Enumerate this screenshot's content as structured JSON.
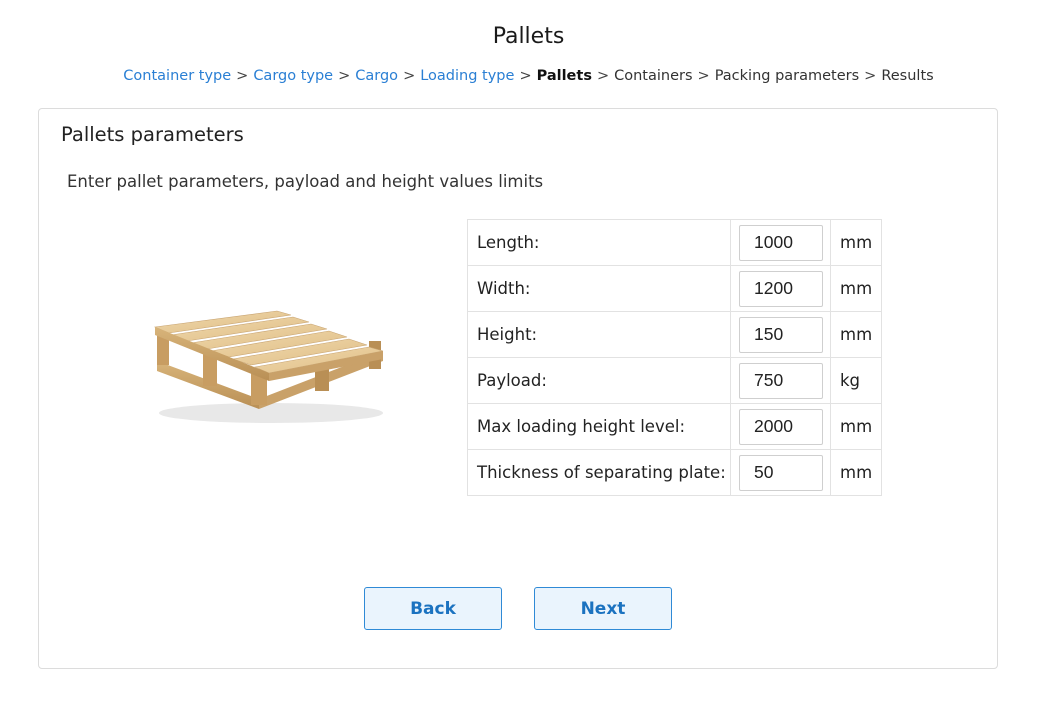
{
  "page": {
    "title": "Pallets"
  },
  "breadcrumb": {
    "separator": ">",
    "items": [
      {
        "label": "Container type"
      },
      {
        "label": "Cargo type"
      },
      {
        "label": "Cargo"
      },
      {
        "label": "Loading type"
      },
      {
        "label": "Pallets"
      },
      {
        "label": "Containers"
      },
      {
        "label": "Packing parameters"
      },
      {
        "label": "Results"
      }
    ]
  },
  "panel": {
    "title": "Pallets parameters",
    "instructions": "Enter pallet parameters, payload and height values limits"
  },
  "params": [
    {
      "label": "Length:",
      "value": "1000",
      "unit": "mm"
    },
    {
      "label": "Width:",
      "value": "1200",
      "unit": "mm"
    },
    {
      "label": "Height:",
      "value": "150",
      "unit": "mm"
    },
    {
      "label": "Payload:",
      "value": "750",
      "unit": "kg"
    },
    {
      "label": "Max loading height level:",
      "value": "2000",
      "unit": "mm"
    },
    {
      "label": "Thickness of separating plate:",
      "value": "50",
      "unit": "mm"
    }
  ],
  "buttons": {
    "back": "Back",
    "next": "Next"
  },
  "colors": {
    "link": "#2a7fd4",
    "button_border": "#2f8ad6",
    "button_bg": "#eaf4fd",
    "button_text": "#1b72c0"
  },
  "icons": {
    "pallet": "wooden-pallet-image"
  }
}
